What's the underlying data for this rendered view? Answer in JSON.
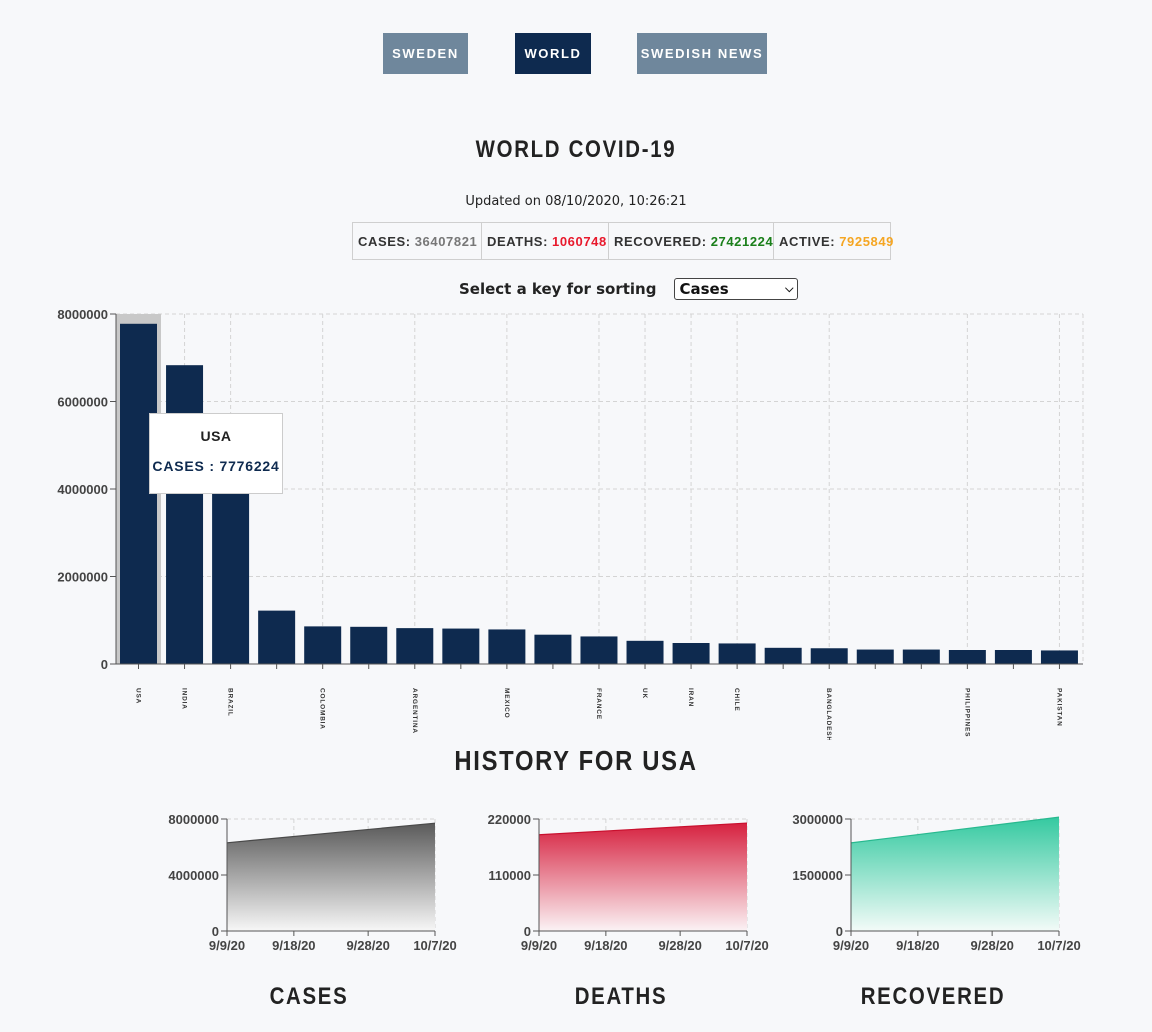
{
  "nav": {
    "sweden": "SWEDEN",
    "world": "WORLD",
    "swedish_news": "SWEDISH NEWS"
  },
  "title": "WORLD COVID-19",
  "updated": "Updated on 08/10/2020, 10:26:21",
  "stats": {
    "cases_label": "CASES:",
    "cases_value": "36407821",
    "deaths_label": "DEATHS:",
    "deaths_value": "1060748",
    "recovered_label": "RECOVERED:",
    "recovered_value": "27421224",
    "active_label": "ACTIVE:",
    "active_value": "7925849"
  },
  "sort": {
    "label": "Select a key for sorting",
    "selected": "Cases"
  },
  "tooltip": {
    "country": "USA",
    "line": "CASES : 7776224"
  },
  "colors": {
    "bar": "#0e2a4f",
    "cases": "#555555",
    "deaths": "#d91a3a",
    "recovered": "#34c9a0"
  },
  "history_title": "HISTORY FOR USA",
  "chart_data": [
    {
      "type": "bar",
      "title": "",
      "highlighted": "USA",
      "ylim": [
        0,
        8000000
      ],
      "yticks": [
        "0",
        "2000000",
        "4000000",
        "6000000",
        "8000000"
      ],
      "yvalues": [
        0,
        2000000,
        4000000,
        6000000,
        8000000
      ],
      "grid": true,
      "categories": [
        "USA",
        "INDIA",
        "BRAZIL",
        "",
        "COLOMBIA",
        "",
        "ARGENTINA",
        "",
        "MEXICO",
        "",
        "FRANCE",
        "UK",
        "IRAN",
        "CHILE",
        "",
        "BANGLADESH",
        "",
        "",
        "PHILIPPINES",
        "",
        "PAKISTAN"
      ],
      "values": [
        7776224,
        6830000,
        5000000,
        1220000,
        860000,
        850000,
        820000,
        810000,
        790000,
        670000,
        630000,
        530000,
        480000,
        470000,
        370000,
        360000,
        330000,
        330000,
        320000,
        320000,
        310000
      ]
    },
    {
      "type": "area",
      "title": "CASES",
      "x": [
        "9/9/20",
        "10/7/20"
      ],
      "xticks": [
        "9/9/20",
        "9/18/20",
        "9/28/20",
        "10/7/20"
      ],
      "yticks": [
        "0",
        "4000000",
        "8000000"
      ],
      "ylim": [
        0,
        8000000
      ],
      "values": [
        6300000,
        7700000
      ],
      "color": "#555555"
    },
    {
      "type": "area",
      "title": "DEATHS",
      "x": [
        "9/9/20",
        "10/7/20"
      ],
      "xticks": [
        "9/9/20",
        "9/18/20",
        "9/28/20",
        "10/7/20"
      ],
      "yticks": [
        "0",
        "110000",
        "220000"
      ],
      "ylim": [
        0,
        220000
      ],
      "values": [
        189000,
        212000
      ],
      "color": "#d91a3a"
    },
    {
      "type": "area",
      "title": "RECOVERED",
      "x": [
        "9/9/20",
        "10/7/20"
      ],
      "xticks": [
        "9/9/20",
        "9/18/20",
        "9/28/20",
        "10/7/20"
      ],
      "yticks": [
        "0",
        "1500000",
        "3000000"
      ],
      "ylim": [
        0,
        3000000
      ],
      "values": [
        2360000,
        3050000
      ],
      "color": "#34c9a0"
    }
  ]
}
